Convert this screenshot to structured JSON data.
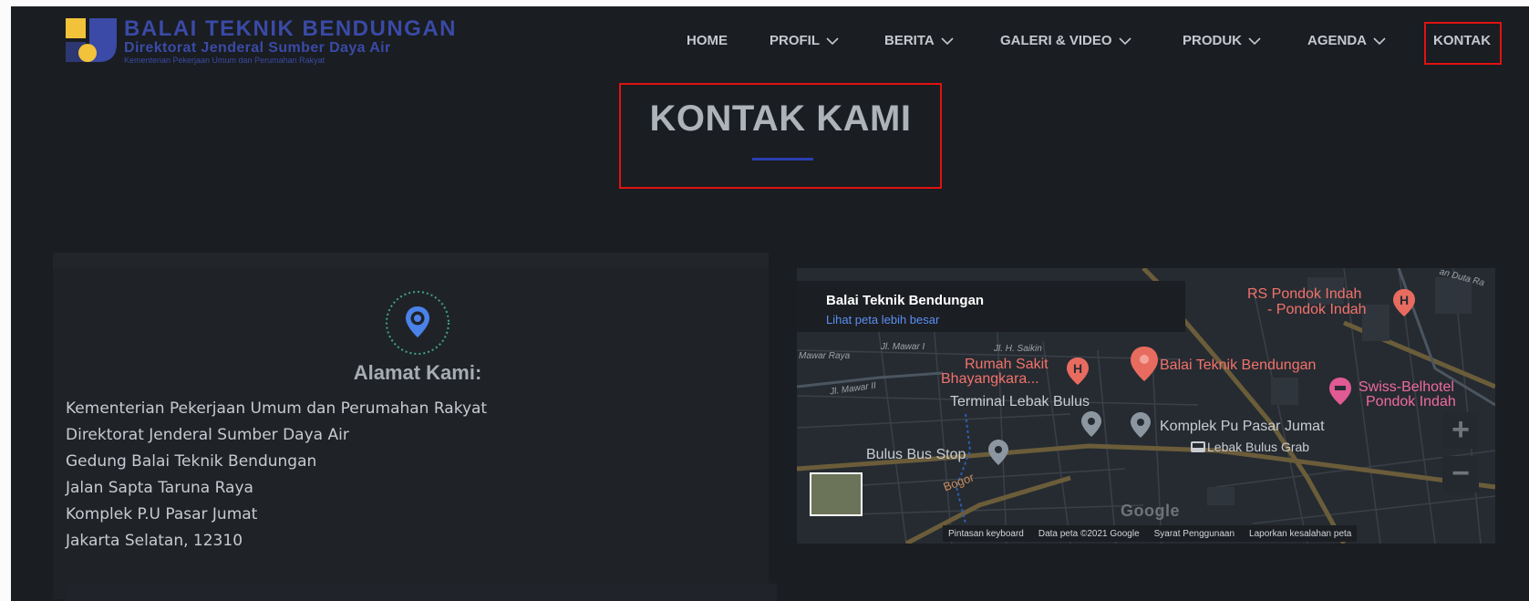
{
  "logo": {
    "line1": "BALAI TEKNIK BENDUNGAN",
    "line2": "Direktorat Jenderal Sumber Daya Air",
    "line3": "Kementerian Pekerjaan Umum dan Perumahan Rakyat"
  },
  "nav": {
    "items": [
      {
        "label": "HOME",
        "dropdown": false
      },
      {
        "label": "PROFIL",
        "dropdown": true
      },
      {
        "label": "BERITA",
        "dropdown": true
      },
      {
        "label": "GALERI & VIDEO",
        "dropdown": true
      },
      {
        "label": "PRODUK",
        "dropdown": true
      },
      {
        "label": "AGENDA",
        "dropdown": true
      },
      {
        "label": "KONTAK",
        "dropdown": false,
        "active": true
      }
    ]
  },
  "page": {
    "title": "KONTAK KAMI"
  },
  "address": {
    "heading": "Alamat Kami:",
    "icon": "location-pin-icon",
    "lines": [
      "Kementerian Pekerjaan Umum dan Perumahan Rakyat",
      "Direktorat Jenderal Sumber Daya Air",
      "Gedung Balai Teknik Bendungan",
      "Jalan Sapta Taruna Raya",
      "Komplek P.U Pasar Jumat",
      "Jakarta Selatan, 12310"
    ]
  },
  "map": {
    "place_name": "Balai Teknik Bendungan",
    "view_larger": "Lihat peta lebih besar",
    "labels": {
      "rs_pondok_indah_1": "RS Pondok Indah",
      "rs_pondok_indah_2": "- Pondok Indah",
      "rumah_sakit_1": "Rumah Sakit",
      "rumah_sakit_2": "Bhayangkara...",
      "balai_marker": "Balai Teknik Bendungan",
      "swiss_1": "Swiss-Belhotel",
      "swiss_2": "Pondok Indah",
      "terminal": "Terminal Lebak Bulus",
      "komplek": "Komplek Pu Pasar Jumat",
      "bus_stop": "Bulus Bus Stop",
      "lebak_grab": "Lebak Bulus Grab",
      "bogor": "Bogor",
      "jl_mawar": "Jl. Mawar I",
      "jl_mawar_raya": "Mawar Raya",
      "jl_mawar_ii": "Jl. Mawar II",
      "jl_h_saikin": "Jl. H. Saikin",
      "duta": "an Duta Ra"
    },
    "zoom_in": "+",
    "zoom_out": "−",
    "google": "Google",
    "footer": [
      "Pintasan keyboard",
      "Data peta ©2021 Google",
      "Syarat Penggunaan",
      "Laporkan kesalahan peta"
    ]
  },
  "colors": {
    "page_bg": "#1a1d21",
    "accent_blue": "#2a3fb0",
    "highlight_red": "#e11212",
    "pin_teal": "#3fa58a"
  }
}
